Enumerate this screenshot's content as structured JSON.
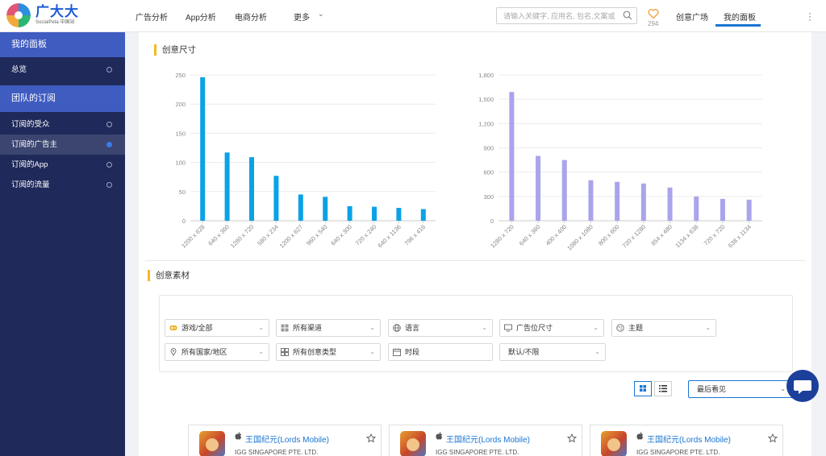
{
  "brand": {
    "name": "广大大",
    "subtitle": "SocialPeta 中国站"
  },
  "topnav": {
    "items": [
      "广告分析",
      "App分析",
      "电商分析",
      "更多"
    ],
    "search_placeholder": "请输入关键字, 应用名, 包名,文案或",
    "favorites_count": "294",
    "right_items": [
      "创意广场",
      "我的面板"
    ],
    "active": "我的面板"
  },
  "sidebar": {
    "section1": "我的面板",
    "overview": "总览",
    "section2": "团队的订阅",
    "items": [
      {
        "label": "订阅的受众",
        "active": false
      },
      {
        "label": "订阅的广告主",
        "active": true
      },
      {
        "label": "订阅的App",
        "active": false
      },
      {
        "label": "订阅的流量",
        "active": false
      }
    ]
  },
  "sections": {
    "size_title": "创意尺寸",
    "material_title": "创意素材"
  },
  "chart_data": [
    {
      "type": "bar",
      "categories": [
        "1200 x 628",
        "640 x 360",
        "1280 x 720",
        "580 x 234",
        "1200 x 627",
        "960 x 540",
        "640 x 300",
        "720 x 240",
        "640 x 1136",
        "796 x 416"
      ],
      "values": [
        246,
        117,
        109,
        77,
        45,
        41,
        25,
        24,
        22,
        20
      ],
      "ylim": [
        0,
        250
      ],
      "yticks": [
        "250",
        "200",
        "150",
        "100",
        "50",
        "0"
      ],
      "color": "#0ba2e6",
      "grid": true
    },
    {
      "type": "bar",
      "categories": [
        "1280 x 720",
        "640 x 360",
        "400 x 400",
        "1080 x 1080",
        "800 x 600",
        "720 x 1280",
        "854 x 480",
        "1134 x 638",
        "720 x 720",
        "638 x 1134"
      ],
      "values": [
        1590,
        800,
        750,
        500,
        480,
        460,
        410,
        300,
        270,
        260
      ],
      "ylim": [
        0,
        1800
      ],
      "yticks": [
        "1,800",
        "1,500",
        "1,200",
        "900",
        "600",
        "300",
        "0"
      ],
      "color": "#a9a4ec",
      "grid": true
    }
  ],
  "filters": {
    "row1": [
      "游戏/全部",
      "所有渠道",
      "语言",
      "广告位尺寸",
      "主题"
    ],
    "row2": [
      "所有国家/地区",
      "所有创意类型",
      "时段",
      "默认/不限"
    ]
  },
  "sort": {
    "selected": "最后看见"
  },
  "cards": [
    {
      "title": "王国纪元(Lords Mobile)",
      "company": "IGG SINGAPORE PTE. LTD."
    },
    {
      "title": "王国纪元(Lords Mobile)",
      "company": "IGG SINGAPORE PTE. LTD."
    },
    {
      "title": "王国纪元(Lords Mobile)",
      "company": "IGG SINGAPORE PTE. LTD."
    }
  ],
  "colors": {
    "accent": "#1a75d2",
    "sidebar": "#1f2a5a",
    "sidebar_head": "#3f5cc0",
    "section_marker": "#f5b921"
  }
}
